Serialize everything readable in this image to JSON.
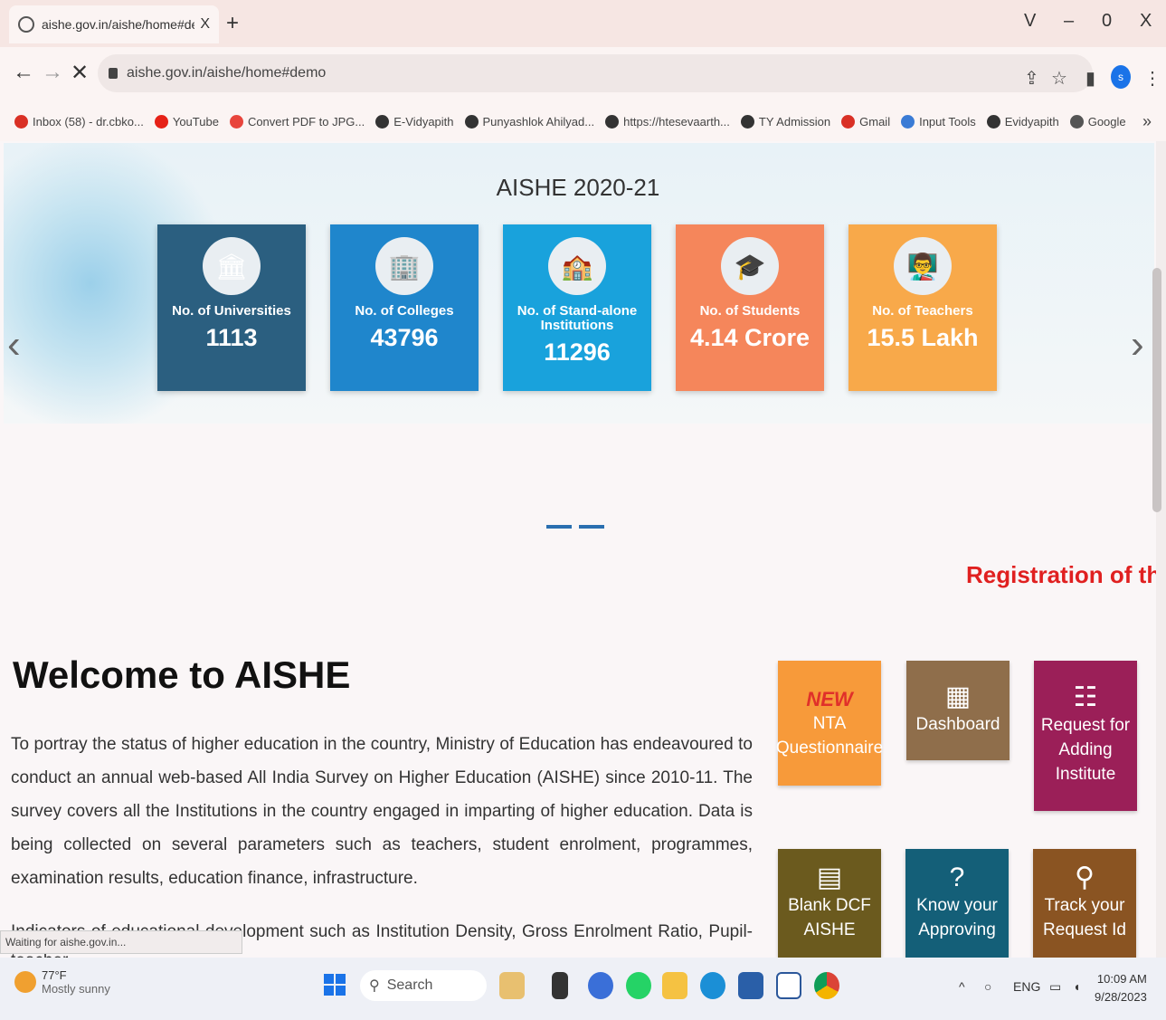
{
  "browser": {
    "tab_title": "aishe.gov.in/aishe/home#demo",
    "tab_close": "X",
    "new_tab": "+",
    "window_controls": [
      "V",
      "–",
      "0",
      "X"
    ],
    "url": "aishe.gov.in/aishe/home#demo",
    "bookmarks": [
      {
        "label": "Inbox (58) - dr.cbko...",
        "icon": "gmail-icon",
        "color": "#d93025"
      },
      {
        "label": "YouTube",
        "icon": "youtube-icon",
        "color": "#e62117"
      },
      {
        "label": "Convert PDF to JPG...",
        "icon": "heart-icon",
        "color": "#e8453c"
      },
      {
        "label": "E-Vidyapith",
        "icon": "globe-icon",
        "color": "#333333"
      },
      {
        "label": "Punyashlok Ahilyad...",
        "icon": "globe-icon",
        "color": "#333333"
      },
      {
        "label": "https://htesevaarth...",
        "icon": "globe-icon",
        "color": "#333333"
      },
      {
        "label": "TY Admission",
        "icon": "globe-icon",
        "color": "#333333"
      },
      {
        "label": "Gmail",
        "icon": "gmail-icon",
        "color": "#d93025"
      },
      {
        "label": "Input Tools",
        "icon": "input-tools-icon",
        "color": "#3a7bd5"
      },
      {
        "label": "Evidyapith",
        "icon": "globe-icon",
        "color": "#333333"
      },
      {
        "label": "Google",
        "icon": "google-icon",
        "color": "#555555"
      }
    ],
    "bookmarks_more": "»",
    "status_text": "Waiting for aishe.gov.in..."
  },
  "hero": {
    "title": "AISHE 2020-21",
    "cards": [
      {
        "label": "No. of Universities",
        "value": "1113",
        "icon": "university-icon",
        "color": "#2b5f80"
      },
      {
        "label": "No. of Colleges",
        "value": "43796",
        "icon": "college-icon",
        "color": "#1f86cc"
      },
      {
        "label": "No. of Stand-alone Institutions",
        "value": "11296",
        "icon": "institution-icon",
        "color": "#19a2dc"
      },
      {
        "label": "No. of Students",
        "value": "4.14 Crore",
        "icon": "student-icon",
        "color": "#f5865b"
      },
      {
        "label": "No. of Teachers",
        "value": "15.5 Lakh",
        "icon": "teacher-icon",
        "color": "#f8a94a"
      }
    ],
    "prev": "‹",
    "next": "›"
  },
  "registration_text": "Registration of the",
  "welcome": {
    "heading": "Welcome to AISHE",
    "paragraph": "To portray the status of higher education in the country, Ministry of Education has endeavoured to conduct an annual web-based All India Survey on Higher Education (AISHE) since 2010-11. The survey covers all the Institutions in the country engaged in imparting of higher education. Data is being collected on several parameters such as teachers, student enrolment, programmes, examination results, education finance, infrastructure.",
    "paragraph2": "Indicators of educational development such as Institution Density, Gross Enrolment Ratio, Pupil-teacher"
  },
  "tiles": [
    {
      "label": "NTA Questionnaire",
      "badge": "NEW",
      "color": "#f79a3a",
      "icon": "new-badge-icon"
    },
    {
      "label": "Dashboard",
      "color": "#8f6e4b",
      "icon": "dashboard-icon"
    },
    {
      "label": "Request for Adding Institute",
      "color": "#9b1f58",
      "icon": "checklist-icon"
    },
    {
      "label": "Blank DCF AISHE",
      "color": "#6b5a1e",
      "icon": "document-icon"
    },
    {
      "label": "Know your Approving",
      "color": "#145f78",
      "icon": "question-icon"
    },
    {
      "label": "Track your Request Id",
      "color": "#8a5422",
      "icon": "search-icon"
    }
  ],
  "taskbar": {
    "temperature": "77°F",
    "weather": "Mostly sunny",
    "search_placeholder": "Search",
    "language": "ENG",
    "time": "10:09 AM",
    "date": "9/28/2023"
  }
}
